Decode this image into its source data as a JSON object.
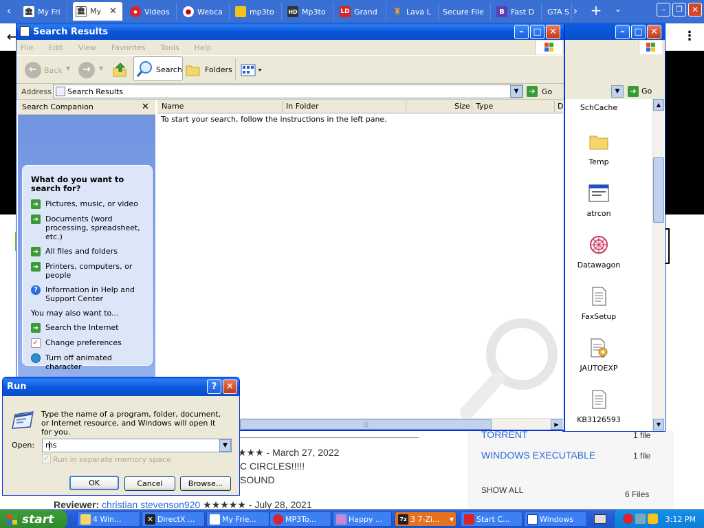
{
  "browser": {
    "tabs": [
      {
        "label": "My Fri",
        "icon": "museum-icon"
      },
      {
        "label": "My",
        "icon": "museum-icon",
        "active": true
      },
      {
        "label": "Videos",
        "icon": "red-globe-icon"
      },
      {
        "label": "Webca",
        "icon": "record-icon"
      },
      {
        "label": "mp3to",
        "icon": "yellow-square-icon"
      },
      {
        "label": "Mp3to",
        "icon": "hd-icon"
      },
      {
        "label": "Grand",
        "icon": "ld-icon"
      },
      {
        "label": "Lava L",
        "icon": "lava-icon"
      },
      {
        "label": "Secure File",
        "icon": "none"
      },
      {
        "label": "Fast D",
        "icon": "b-icon"
      },
      {
        "label": "GTA S",
        "icon": "none"
      }
    ],
    "tab_close": "✕",
    "new_tab": "+",
    "back_symbol": "←",
    "menu_symbol": "⋮"
  },
  "explorer": {
    "title": "Search Results",
    "menu": [
      "File",
      "Edit",
      "View",
      "Favorites",
      "Tools",
      "Help"
    ],
    "toolbar": {
      "back": "Back",
      "search": "Search",
      "folders": "Folders"
    },
    "address_label": "Address",
    "address_value": "Search Results",
    "go": "Go",
    "companion": {
      "header": "Search Companion",
      "close": "✕",
      "question": "What do you want to search for?",
      "options": [
        "Pictures, music, or video",
        "Documents (word processing, spreadsheet, etc.)",
        "All files and folders",
        "Printers, computers, or people",
        "Information in Help and Support Center"
      ],
      "also_label": "You may also want to...",
      "also": [
        "Search the Internet",
        "Change preferences",
        "Turn off animated character"
      ]
    },
    "columns": [
      "Name",
      "In Folder",
      "Size",
      "Type",
      "D"
    ],
    "empty_message": "To start your search, follow the instructions in the left pane."
  },
  "explorer2": {
    "go": "Go",
    "items": [
      "SchCache",
      "Temp",
      "atrcon",
      "Datawagon",
      "FaxSetup",
      "JAUTOEXP",
      "KB3126593"
    ]
  },
  "webpage": {
    "rating_date": "★★★ - March 27, 2022",
    "review_line1": "C CIRCLES!!!!!",
    "review_line2": "SOUND",
    "reviewer_label": "Reviewer:",
    "reviewer_name": "christian stevenson920",
    "reviewer_date": "★★★★★ - July 28, 2021",
    "side": [
      {
        "label": "TORRENT",
        "count": "1 file"
      },
      {
        "label": "WINDOWS EXECUTABLE",
        "count": "1 file"
      }
    ],
    "show_all": "SHOW ALL",
    "show_all_count": "6 Files",
    "link_color": "#2b6ad8"
  },
  "run_dialog": {
    "title": "Run",
    "help": "?",
    "close": "✕",
    "description": "Type the name of a program, folder, document, or Internet resource, and Windows will open it for you.",
    "open_label": "Open:",
    "open_value": "ms",
    "checkbox_label": "Run in separate memory space",
    "ok": "OK",
    "cancel": "Cancel",
    "browse": "Browse..."
  },
  "taskbar": {
    "start": "start",
    "tasks": [
      {
        "label": "4 Win...",
        "icon": "folder-icon"
      },
      {
        "label": "DirectX ...",
        "icon": "directx-icon"
      },
      {
        "label": "My Frie...",
        "icon": "ie-icon"
      },
      {
        "label": "MP3To...",
        "icon": "opera-icon"
      },
      {
        "label": "Happy ...",
        "icon": "paint-icon"
      },
      {
        "label": "3 7-Zi...",
        "icon": "7zip-icon",
        "active": true
      },
      {
        "label": "Start C...",
        "icon": "start-icon"
      },
      {
        "label": "Windows",
        "icon": "window-icon"
      }
    ],
    "clock": "3:12 PM"
  }
}
